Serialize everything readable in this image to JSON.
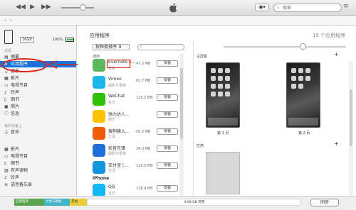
{
  "search": {
    "placeholder": "搜索"
  },
  "device": {
    "capacity": "16GB",
    "battery": "100%"
  },
  "sidebar": {
    "settings_header": "设置",
    "on_device_header": "我的设备上",
    "items": [
      {
        "label": "摘要",
        "icon": "summary-icon"
      },
      {
        "label": "应用程序",
        "icon": "apps-icon"
      },
      {
        "label": "音乐",
        "icon": "music-icon"
      },
      {
        "label": "影片",
        "icon": "movie-icon"
      },
      {
        "label": "电视节目",
        "icon": "tv-icon"
      },
      {
        "label": "铃声",
        "icon": "bell-icon"
      },
      {
        "label": "图书",
        "icon": "book-icon"
      },
      {
        "label": "照片",
        "icon": "photo-icon"
      },
      {
        "label": "信息",
        "icon": "info-icon"
      }
    ],
    "device_items": [
      {
        "label": "音乐",
        "icon": "music-icon"
      },
      {
        "label": "影片",
        "icon": "movie-icon"
      },
      {
        "label": "电视节目",
        "icon": "tv-icon"
      },
      {
        "label": "图书",
        "icon": "book-icon"
      },
      {
        "label": "有声读物",
        "icon": "audiobook-icon"
      },
      {
        "label": "铃声",
        "icon": "bell-icon"
      },
      {
        "label": "语音备忘录",
        "icon": "voice-memo-icon"
      }
    ]
  },
  "main": {
    "title": "应用程序",
    "sort_label": "按种类排序",
    "group_label": "通用",
    "iphone_label": "iPhone",
    "install_label": "安装",
    "apps": [
      {
        "name": "Evernote S...",
        "category": "效率",
        "size": "47.2 MB",
        "color": "#5cb85c"
      },
      {
        "name": "Vimeo",
        "category": "摄影与录像",
        "size": "82.7 MB",
        "color": "#1ab7ea"
      },
      {
        "name": "WeChat",
        "category": "社交",
        "size": "116.2 MB",
        "color": "#2dc100"
      },
      {
        "name": "驰力达人...",
        "category": "娱乐",
        "size": "",
        "color": "#ffc300"
      },
      {
        "name": "搜狗输入...",
        "category": "工具",
        "size": "56.2 MB",
        "color": "#f25c05"
      },
      {
        "name": "影音先锋",
        "category": "摄影与录像",
        "size": "34.3 MB",
        "color": "#1e6fd9"
      },
      {
        "name": "支付宝 (...",
        "category": "生活",
        "size": "116.5 MB",
        "color": "#1296db"
      },
      {
        "name": "QQ",
        "category": "社交",
        "size": "138.9 MB",
        "color": "#12b7f5"
      }
    ]
  },
  "right": {
    "count_label": "15 个应用程序",
    "home_label": "主屏幕",
    "page1": "第 1 页",
    "page2": "第 2 页",
    "apps_label": "应用"
  },
  "storage": {
    "apps": "应用程序",
    "docs": "文档与数据",
    "other": "其他",
    "free": "9.08 GB 可用",
    "sync": "同步"
  }
}
